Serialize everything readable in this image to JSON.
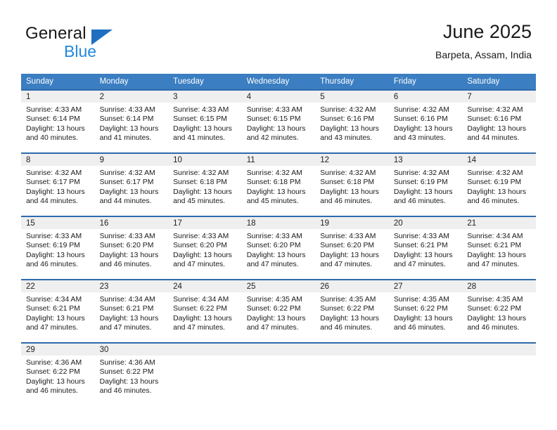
{
  "brand": {
    "name_part1": "General",
    "name_part2": "Blue",
    "triangle_color": "#1e6fc0",
    "blue_text_color": "#2288dd"
  },
  "header": {
    "month_title": "June 2025",
    "location": "Barpeta, Assam, India"
  },
  "theme": {
    "header_row_bg": "#3b7ec1",
    "row_top_border": "#2f6aad",
    "daynum_bg": "#efefef",
    "page_bg": "#ffffff"
  },
  "weekday_headers": [
    "Sunday",
    "Monday",
    "Tuesday",
    "Wednesday",
    "Thursday",
    "Friday",
    "Saturday"
  ],
  "weeks": [
    {
      "days": [
        {
          "num": "1",
          "sunrise": "Sunrise: 4:33 AM",
          "sunset": "Sunset: 6:14 PM",
          "daylight": "Daylight: 13 hours and 40 minutes."
        },
        {
          "num": "2",
          "sunrise": "Sunrise: 4:33 AM",
          "sunset": "Sunset: 6:14 PM",
          "daylight": "Daylight: 13 hours and 41 minutes."
        },
        {
          "num": "3",
          "sunrise": "Sunrise: 4:33 AM",
          "sunset": "Sunset: 6:15 PM",
          "daylight": "Daylight: 13 hours and 41 minutes."
        },
        {
          "num": "4",
          "sunrise": "Sunrise: 4:33 AM",
          "sunset": "Sunset: 6:15 PM",
          "daylight": "Daylight: 13 hours and 42 minutes."
        },
        {
          "num": "5",
          "sunrise": "Sunrise: 4:32 AM",
          "sunset": "Sunset: 6:16 PM",
          "daylight": "Daylight: 13 hours and 43 minutes."
        },
        {
          "num": "6",
          "sunrise": "Sunrise: 4:32 AM",
          "sunset": "Sunset: 6:16 PM",
          "daylight": "Daylight: 13 hours and 43 minutes."
        },
        {
          "num": "7",
          "sunrise": "Sunrise: 4:32 AM",
          "sunset": "Sunset: 6:16 PM",
          "daylight": "Daylight: 13 hours and 44 minutes."
        }
      ]
    },
    {
      "days": [
        {
          "num": "8",
          "sunrise": "Sunrise: 4:32 AM",
          "sunset": "Sunset: 6:17 PM",
          "daylight": "Daylight: 13 hours and 44 minutes."
        },
        {
          "num": "9",
          "sunrise": "Sunrise: 4:32 AM",
          "sunset": "Sunset: 6:17 PM",
          "daylight": "Daylight: 13 hours and 44 minutes."
        },
        {
          "num": "10",
          "sunrise": "Sunrise: 4:32 AM",
          "sunset": "Sunset: 6:18 PM",
          "daylight": "Daylight: 13 hours and 45 minutes."
        },
        {
          "num": "11",
          "sunrise": "Sunrise: 4:32 AM",
          "sunset": "Sunset: 6:18 PM",
          "daylight": "Daylight: 13 hours and 45 minutes."
        },
        {
          "num": "12",
          "sunrise": "Sunrise: 4:32 AM",
          "sunset": "Sunset: 6:18 PM",
          "daylight": "Daylight: 13 hours and 46 minutes."
        },
        {
          "num": "13",
          "sunrise": "Sunrise: 4:32 AM",
          "sunset": "Sunset: 6:19 PM",
          "daylight": "Daylight: 13 hours and 46 minutes."
        },
        {
          "num": "14",
          "sunrise": "Sunrise: 4:32 AM",
          "sunset": "Sunset: 6:19 PM",
          "daylight": "Daylight: 13 hours and 46 minutes."
        }
      ]
    },
    {
      "days": [
        {
          "num": "15",
          "sunrise": "Sunrise: 4:33 AM",
          "sunset": "Sunset: 6:19 PM",
          "daylight": "Daylight: 13 hours and 46 minutes."
        },
        {
          "num": "16",
          "sunrise": "Sunrise: 4:33 AM",
          "sunset": "Sunset: 6:20 PM",
          "daylight": "Daylight: 13 hours and 46 minutes."
        },
        {
          "num": "17",
          "sunrise": "Sunrise: 4:33 AM",
          "sunset": "Sunset: 6:20 PM",
          "daylight": "Daylight: 13 hours and 47 minutes."
        },
        {
          "num": "18",
          "sunrise": "Sunrise: 4:33 AM",
          "sunset": "Sunset: 6:20 PM",
          "daylight": "Daylight: 13 hours and 47 minutes."
        },
        {
          "num": "19",
          "sunrise": "Sunrise: 4:33 AM",
          "sunset": "Sunset: 6:20 PM",
          "daylight": "Daylight: 13 hours and 47 minutes."
        },
        {
          "num": "20",
          "sunrise": "Sunrise: 4:33 AM",
          "sunset": "Sunset: 6:21 PM",
          "daylight": "Daylight: 13 hours and 47 minutes."
        },
        {
          "num": "21",
          "sunrise": "Sunrise: 4:34 AM",
          "sunset": "Sunset: 6:21 PM",
          "daylight": "Daylight: 13 hours and 47 minutes."
        }
      ]
    },
    {
      "days": [
        {
          "num": "22",
          "sunrise": "Sunrise: 4:34 AM",
          "sunset": "Sunset: 6:21 PM",
          "daylight": "Daylight: 13 hours and 47 minutes."
        },
        {
          "num": "23",
          "sunrise": "Sunrise: 4:34 AM",
          "sunset": "Sunset: 6:21 PM",
          "daylight": "Daylight: 13 hours and 47 minutes."
        },
        {
          "num": "24",
          "sunrise": "Sunrise: 4:34 AM",
          "sunset": "Sunset: 6:22 PM",
          "daylight": "Daylight: 13 hours and 47 minutes."
        },
        {
          "num": "25",
          "sunrise": "Sunrise: 4:35 AM",
          "sunset": "Sunset: 6:22 PM",
          "daylight": "Daylight: 13 hours and 47 minutes."
        },
        {
          "num": "26",
          "sunrise": "Sunrise: 4:35 AM",
          "sunset": "Sunset: 6:22 PM",
          "daylight": "Daylight: 13 hours and 46 minutes."
        },
        {
          "num": "27",
          "sunrise": "Sunrise: 4:35 AM",
          "sunset": "Sunset: 6:22 PM",
          "daylight": "Daylight: 13 hours and 46 minutes."
        },
        {
          "num": "28",
          "sunrise": "Sunrise: 4:35 AM",
          "sunset": "Sunset: 6:22 PM",
          "daylight": "Daylight: 13 hours and 46 minutes."
        }
      ]
    },
    {
      "days": [
        {
          "num": "29",
          "sunrise": "Sunrise: 4:36 AM",
          "sunset": "Sunset: 6:22 PM",
          "daylight": "Daylight: 13 hours and 46 minutes."
        },
        {
          "num": "30",
          "sunrise": "Sunrise: 4:36 AM",
          "sunset": "Sunset: 6:22 PM",
          "daylight": "Daylight: 13 hours and 46 minutes."
        },
        {
          "num": "",
          "sunrise": "",
          "sunset": "",
          "daylight": ""
        },
        {
          "num": "",
          "sunrise": "",
          "sunset": "",
          "daylight": ""
        },
        {
          "num": "",
          "sunrise": "",
          "sunset": "",
          "daylight": ""
        },
        {
          "num": "",
          "sunrise": "",
          "sunset": "",
          "daylight": ""
        },
        {
          "num": "",
          "sunrise": "",
          "sunset": "",
          "daylight": ""
        }
      ]
    }
  ]
}
